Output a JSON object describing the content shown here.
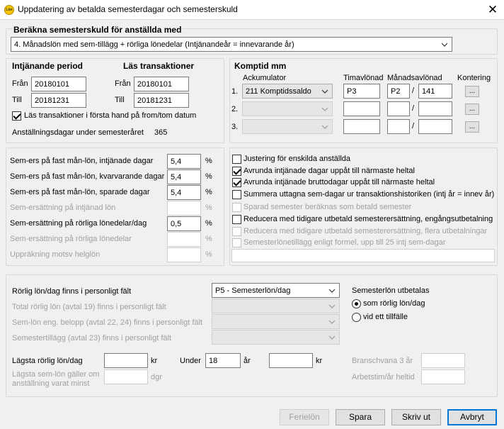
{
  "window": {
    "title": "Uppdatering av betalda semesterdagar och semesterskuld",
    "icon_text": "Lön",
    "close_glyph": "✕"
  },
  "calc": {
    "heading": "Beräkna semesterskuld för anställda med",
    "selected": "4.   Månadslön med sem-tillägg + rörliga lönedelar (Intjänandeår = innevarande år)"
  },
  "period": {
    "heading": "Intjänande period",
    "from_label": "Från",
    "from_value": "20180101",
    "to_label": "Till",
    "to_value": "20181231"
  },
  "trans": {
    "heading": "Läs transaktioner",
    "from_label": "Från",
    "from_value": "20180101",
    "to_label": "Till",
    "to_value": "20181231",
    "checkbox_label": "Läs transaktioner i första hand på from/tom datum",
    "checkbox_checked": true,
    "days_label": "Anställningsdagar under semesteråret",
    "days_value": "365"
  },
  "komptid": {
    "heading": "Komptid mm",
    "col_acc": "Ackumulator",
    "col_tim": "Timavlönad",
    "col_man": "Månadsavlönad",
    "col_kont": "Kontering",
    "rows": [
      {
        "num": "1.",
        "acc": "211 Komptidssaldo",
        "tim": "P3",
        "man_a": "P2",
        "man_b": "141",
        "btn": "..."
      },
      {
        "num": "2.",
        "acc": "",
        "tim": "",
        "man_a": "",
        "man_b": "",
        "btn": "..."
      },
      {
        "num": "3.",
        "acc": "",
        "tim": "",
        "man_a": "",
        "man_b": "",
        "btn": "..."
      }
    ],
    "slash": "/"
  },
  "rates": {
    "pct": "%",
    "rows": [
      {
        "label": "Sem-ers på fast mån-lön, intjänade dagar",
        "value": "5,4"
      },
      {
        "label": "Sem-ers på fast mån-lön, kvarvarande dagar",
        "value": "5,4"
      },
      {
        "label": "Sem-ers på fast mån-lön, sparade dagar",
        "value": "5,4"
      },
      {
        "label": "Sem-ersättning på intjänad lön",
        "value": ""
      },
      {
        "label": "Sem-ersättning på rörliga lönedelar/dag",
        "value": "0,5"
      },
      {
        "label": "Sem-ersättning på rörliga lönedelar",
        "value": ""
      },
      {
        "label": "Uppräkning motsv helglön",
        "value": ""
      }
    ]
  },
  "options": [
    {
      "label": "Justering för enskilda anställda",
      "checked": false,
      "enabled": true
    },
    {
      "label": "Avrunda intjänade dagar uppåt till närmaste heltal",
      "checked": true,
      "enabled": true
    },
    {
      "label": "Avrunda intjänade bruttodagar uppåt till närmaste heltal",
      "checked": true,
      "enabled": true
    },
    {
      "label": "Summera uttagna sem-dagar ur transaktionshistoriken (intj år = innev år)",
      "checked": false,
      "enabled": true
    },
    {
      "label": "Sparad semester beräknas som betald semester",
      "checked": false,
      "enabled": false
    },
    {
      "label": "Reducera med tidigare utbetald semesterersättning, engångsutbetalning",
      "checked": false,
      "enabled": true
    },
    {
      "label": "Reducera med tidigare utbetald semesterersättning, flera utbetalningar",
      "checked": false,
      "enabled": false
    },
    {
      "label": "Semesterlönetillägg enligt formel, upp till 25 intj sem-dagar",
      "checked": false,
      "enabled": false
    }
  ],
  "variable": {
    "rows": [
      {
        "label": "Rörlig lön/dag finns i personligt fält",
        "value": "P5 - Semesterlön/dag"
      },
      {
        "label": "Total rörlig lön (avtal 19)  finns i personligt fält",
        "value": ""
      },
      {
        "label": "Sem-lön eng. belopp (avtal 22, 24) finns i personligt fält",
        "value": ""
      },
      {
        "label": "Semestertillägg (avtal 23) finns i personligt fält",
        "value": ""
      }
    ],
    "paid_heading": "Semesterlön utbetalas",
    "radio1": "som rörlig lön/dag",
    "radio2": "vid ett tillfälle",
    "radio_selected": 1,
    "min_label": "Lägsta rörlig lön/dag",
    "min_value": "",
    "kr": "kr",
    "under_label": "Under",
    "under_value": "18",
    "ar": "år",
    "amount_value": "",
    "kr2": "kr",
    "min_sem_label1": "Lägsta sem-lön gäller om",
    "min_sem_label2": "anställning varat minst",
    "min_sem_value": "",
    "dgr": "dgr",
    "bransch_label": "Branschvana 3 år",
    "bransch_value": "",
    "arbetstim_label": "Arbetstim/år heltid",
    "arbetstim_value": ""
  },
  "buttons": {
    "ferielon": "Ferielön",
    "spara": "Spara",
    "skriv_ut": "Skriv ut",
    "avbryt": "Avbryt"
  }
}
